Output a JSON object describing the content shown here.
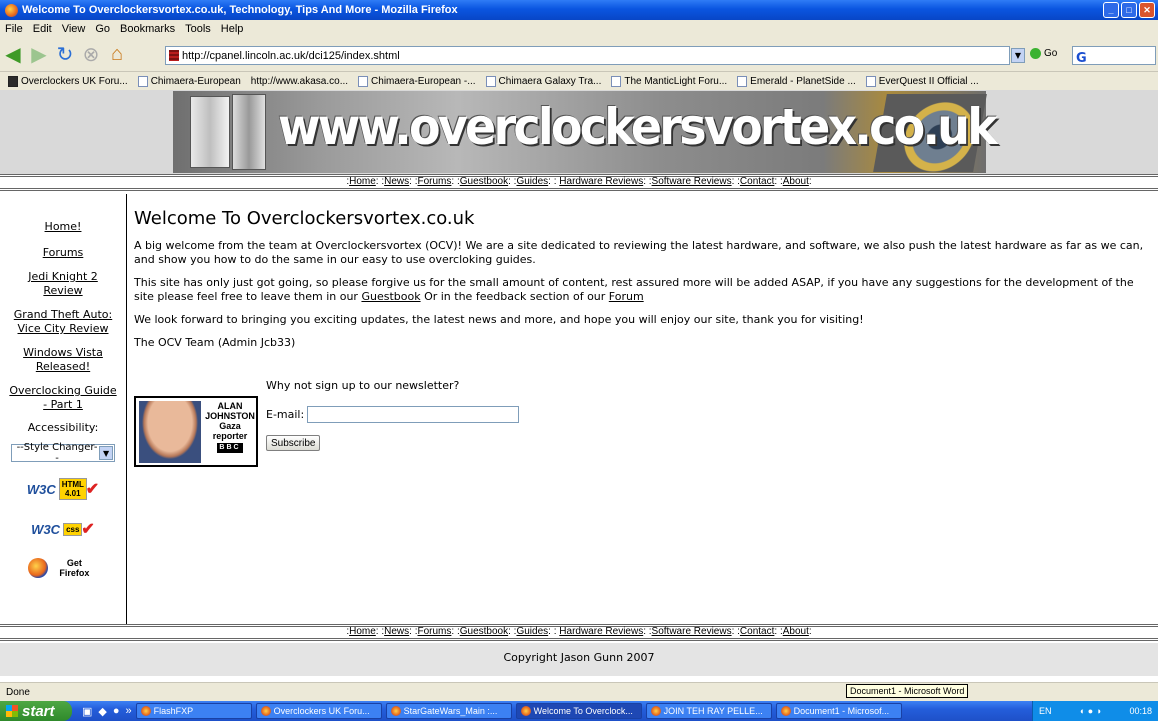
{
  "window": {
    "title": "Welcome To Overclockersvortex.co.uk, Technology, Tips And More - Mozilla Firefox"
  },
  "menu": [
    "File",
    "Edit",
    "View",
    "Go",
    "Bookmarks",
    "Tools",
    "Help"
  ],
  "address": {
    "url": "http://cpanel.lincoln.ac.uk/dci125/index.shtml",
    "go_label": "Go"
  },
  "bookmarks": [
    "Overclockers UK Foru...",
    "Chimaera-European",
    "http://www.akasa.co...",
    "Chimaera-European -...",
    "Chimaera Galaxy Tra...",
    "The ManticLight Foru...",
    "Emerald - PlanetSide ...",
    "EverQuest II Official ..."
  ],
  "banner": {
    "site_name": "www.overclockersvortex.co.uk"
  },
  "topnav": {
    "home": "Home",
    "news": "News",
    "forums": "Forums",
    "guestbook": "Guestbook",
    "guides": "Guides",
    "hardware": "Hardware Reviews",
    "software": "Software Reviews",
    "contact": "Contact",
    "about": "About"
  },
  "sidebar": {
    "home": "Home!",
    "forums": "Forums",
    "jedi_1": "Jedi Knight 2",
    "jedi_2": "Review",
    "gta_1": "Grand Theft Auto:",
    "gta_2": "Vice City Review",
    "vista_1": "Windows Vista",
    "vista_2": "Released!",
    "ocguide_1": "Overclocking Guide",
    "ocguide_2": "- Part 1",
    "accessibility": "Accessibility:",
    "style_changer": "--Style Changer--",
    "w3c_html": "HTML 4.01",
    "w3c_css": "css",
    "w3c_mark": "W3C",
    "get_firefox": "Get Firefox"
  },
  "main": {
    "heading": "Welcome To Overclockersvortex.co.uk",
    "p1": "A big welcome from the team at Overclockersvortex (OCV)! We are a site dedicated to reviewing the latest hardware, and software, we also push the latest hardware as far as we can, and show you how to do the same in our easy to use overcloking guides.",
    "p2_a": "This site has only just got going, so please forgive us for the small amount of content, rest assured more will be added ASAP, if you have any suggestions for the development of the site please feel free to leave them in our ",
    "p2_link1": "Guestbook",
    "p2_b": " Or in the feedback section of our ",
    "p2_link2": "Forum",
    "p3": "We look forward to bringing you exciting updates, the latest news and more, and hope you will enjoy our site, thank you for visiting!",
    "sign": "The OCV Team (Admin Jcb33)"
  },
  "newsletter": {
    "prompt": "Why not sign up to our newsletter?",
    "email_label": "E-mail:",
    "email_value": "",
    "subscribe": "Subscribe",
    "alan_1": "ALAN",
    "alan_2": "JOHNSTON",
    "alan_3": "Gaza",
    "alan_4": "reporter",
    "bbc": "BBC"
  },
  "footer": {
    "copyright": "Copyright Jason Gunn 2007"
  },
  "status": {
    "text": "Done",
    "tooltip": "Document1 - Microsoft Word"
  },
  "taskbar": {
    "start": "start",
    "tasks": [
      "FlashFXP",
      "Overclockers UK Foru...",
      "StarGateWars_Main :...",
      "Welcome To Overclock...",
      "JOIN TEH RAY PELLE...",
      "Document1 - Microsof..."
    ],
    "lang": "EN",
    "clock": "00:18"
  }
}
